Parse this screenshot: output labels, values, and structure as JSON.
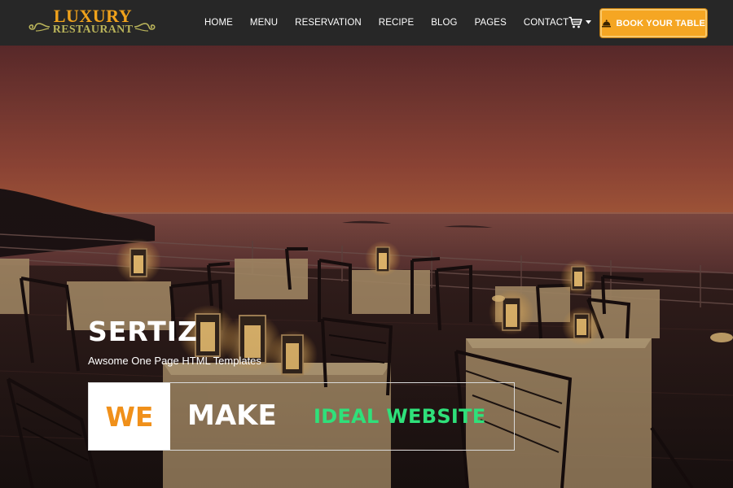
{
  "brand": {
    "line1": "LUXURY",
    "line2": "RESTAURANT",
    "color_primary": "#f0a21b",
    "color_secondary": "#b9b35a"
  },
  "nav": {
    "items": [
      {
        "label": "HOME"
      },
      {
        "label": "MENU"
      },
      {
        "label": "RESERVATION"
      },
      {
        "label": "RECIPE"
      },
      {
        "label": "BLOG"
      },
      {
        "label": "PAGES"
      },
      {
        "label": "CONTACT"
      }
    ],
    "cart_icon": "shopping-cart-icon",
    "dropdown_icon": "caret-down-icon"
  },
  "book_button": {
    "label": "BOOK YOUR TABLE",
    "icon": "service-bell-icon",
    "color": "#f5a623"
  },
  "hero": {
    "title": "SERTIZ",
    "subtitle": "Awsome One Page HTML Templates",
    "tagline": {
      "word1": "WE",
      "word2": "MAKE",
      "word3": "IDEAL WEBSITE",
      "word1_color": "#f0901a",
      "word3_color": "#2fe07a"
    },
    "background": "sunset-restaurant-terrace-photo"
  }
}
